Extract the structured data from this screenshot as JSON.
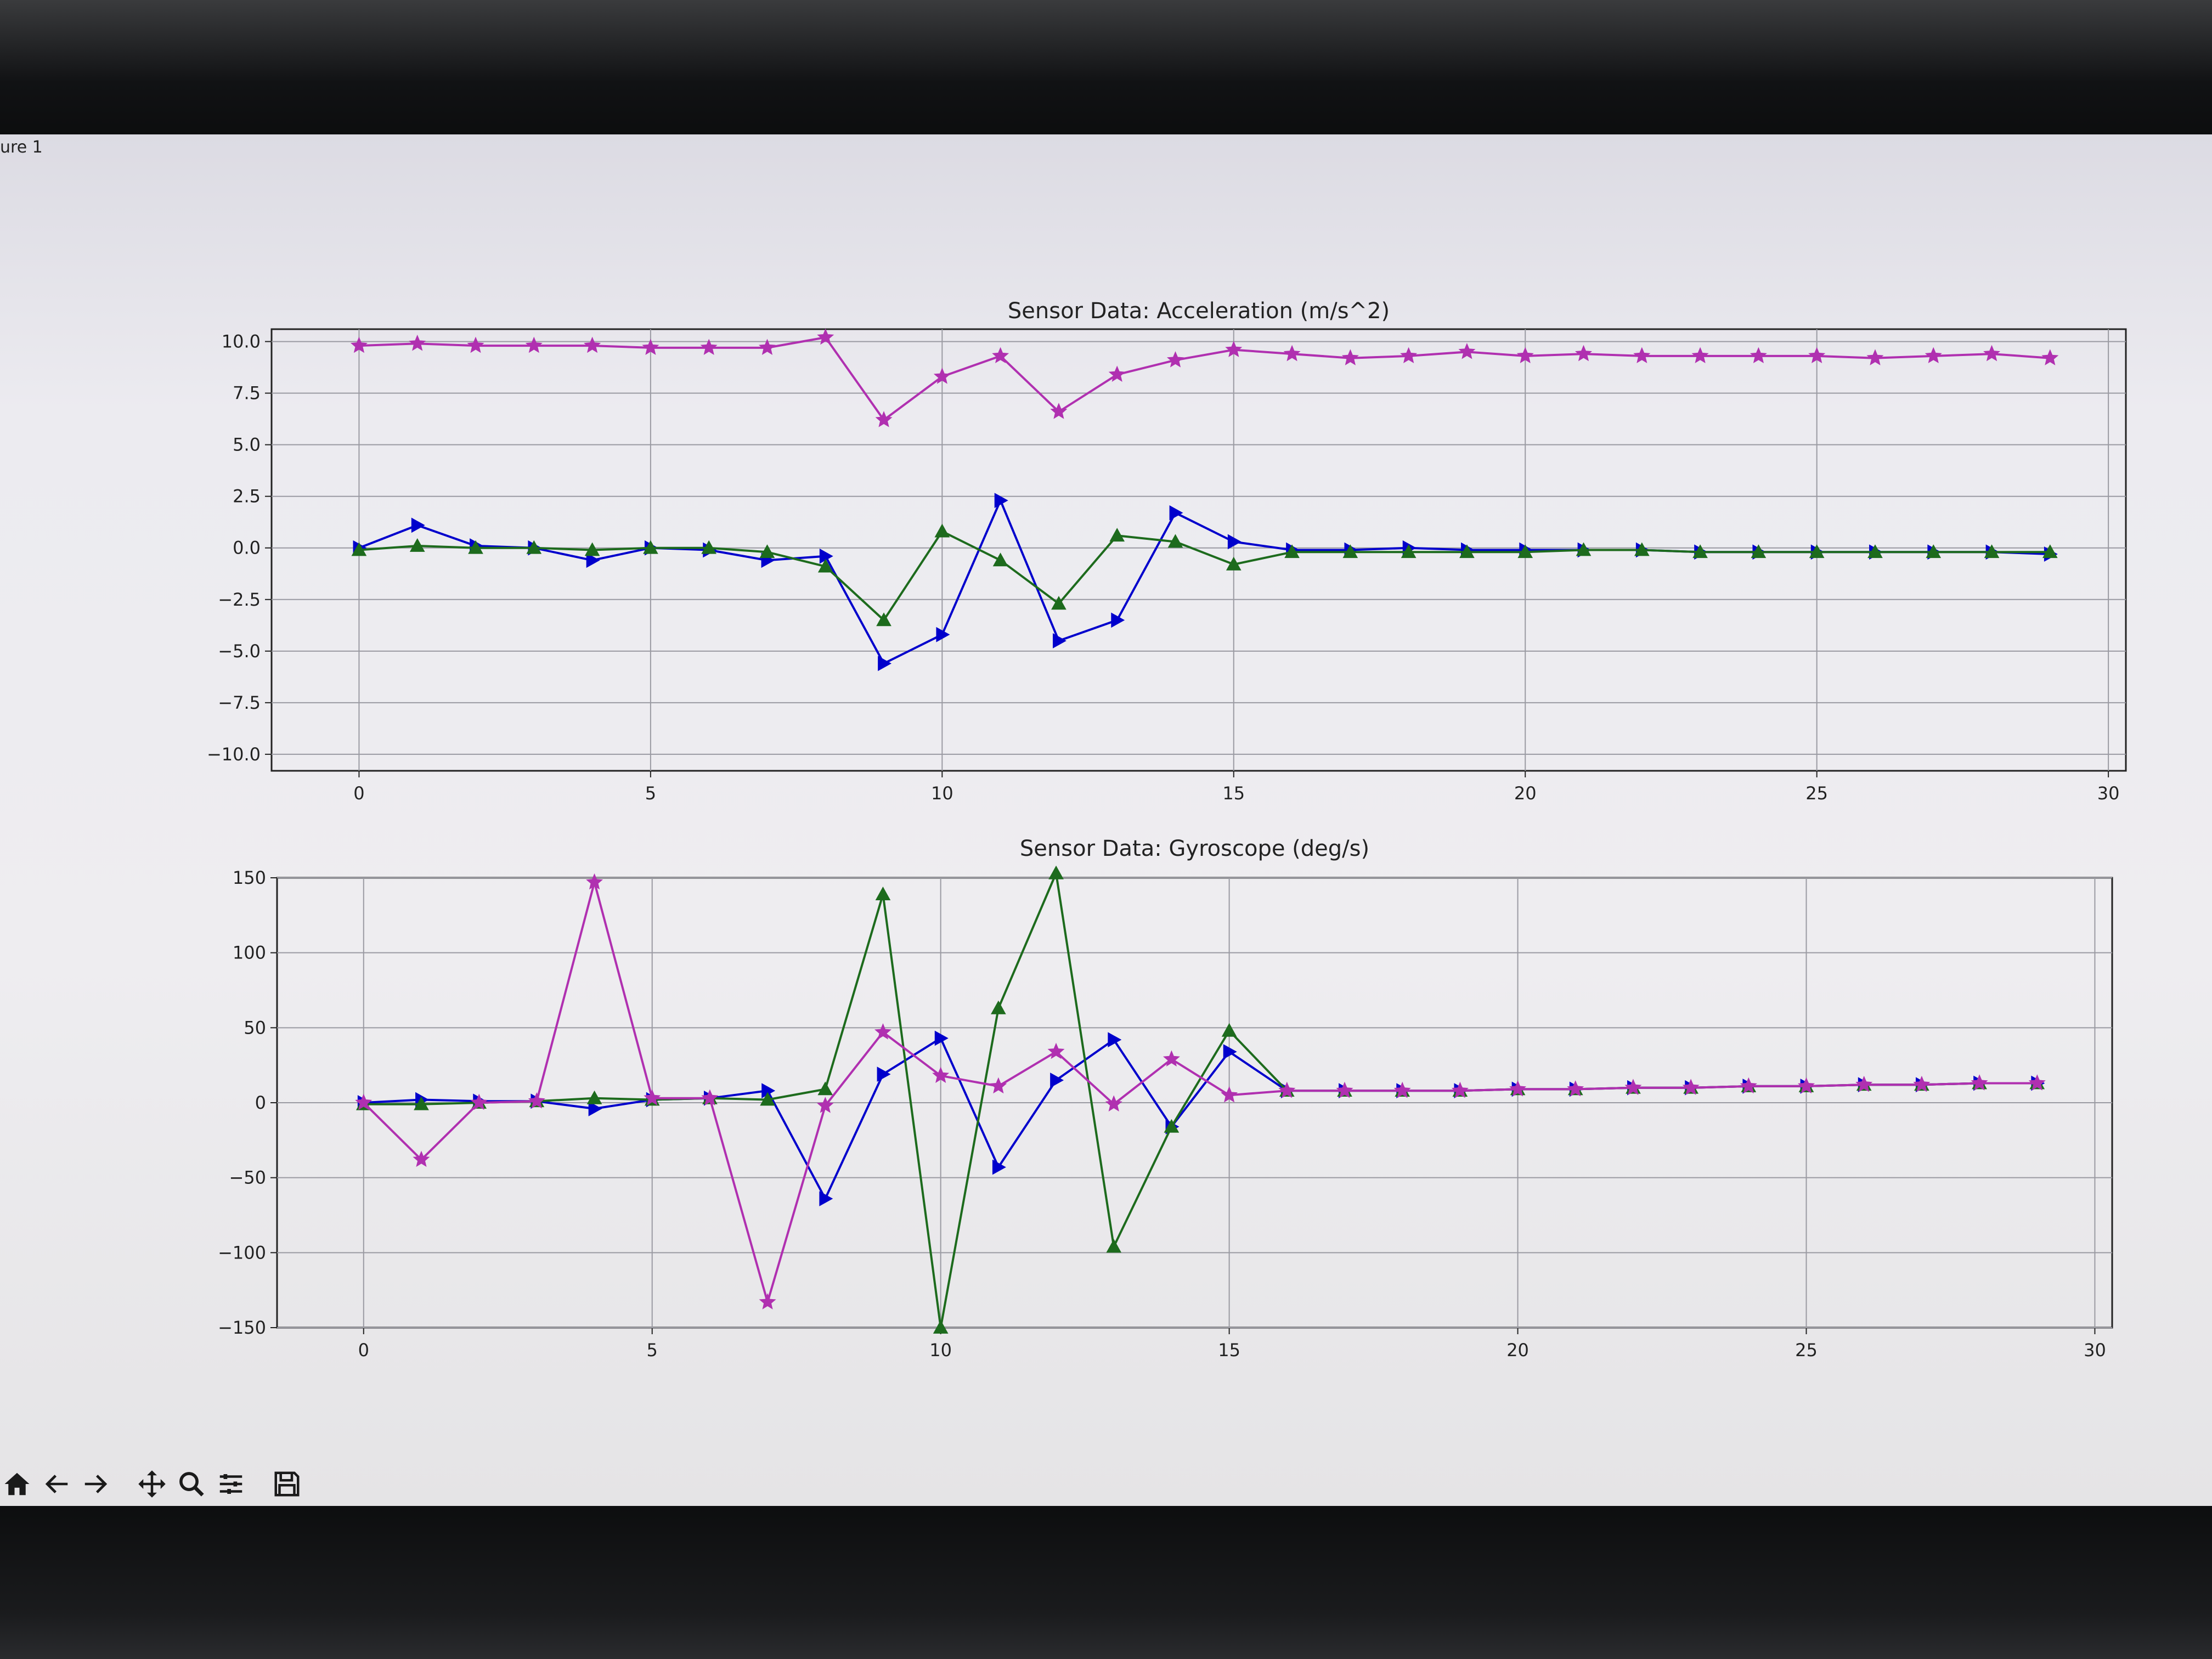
{
  "window": {
    "title": "ure 1"
  },
  "toolbar": {
    "buttons": [
      {
        "name": "home",
        "icon": "home-icon"
      },
      {
        "name": "back",
        "icon": "arrow-left-icon"
      },
      {
        "name": "forward",
        "icon": "arrow-right-icon"
      },
      {
        "name": "pan",
        "icon": "move-icon"
      },
      {
        "name": "zoom",
        "icon": "magnifier-icon"
      },
      {
        "name": "configure",
        "icon": "sliders-icon"
      },
      {
        "name": "save",
        "icon": "floppy-icon"
      }
    ]
  },
  "chart_data": [
    {
      "type": "line",
      "title": "Sensor Data: Acceleration (m/s^2)",
      "xlim": [
        -1.5,
        30.3
      ],
      "ylim": [
        -10.8,
        10.6
      ],
      "xticks": [
        0,
        5,
        10,
        15,
        20,
        25,
        30
      ],
      "yticks": [
        10.0,
        7.5,
        5.0,
        2.5,
        0.0,
        -2.5,
        -5.0,
        -7.5,
        -10.0
      ],
      "ytick_labels": [
        "10.0",
        "7.5",
        "5.0",
        "2.5",
        "0.0",
        "−2.5",
        "−5.0",
        "−7.5",
        "−10.0"
      ],
      "grid": true,
      "x": [
        0,
        1,
        2,
        3,
        4,
        5,
        6,
        7,
        8,
        9,
        10,
        11,
        12,
        13,
        14,
        15,
        16,
        17,
        18,
        19,
        20,
        21,
        22,
        23,
        24,
        25,
        26,
        27,
        28,
        29
      ],
      "series": [
        {
          "color": "#0000cc",
          "marker": "triangle-right",
          "values": [
            0.0,
            1.1,
            0.1,
            0.0,
            -0.6,
            0.0,
            -0.1,
            -0.6,
            -0.4,
            -5.6,
            -4.2,
            2.3,
            -4.5,
            -3.5,
            1.7,
            0.3,
            -0.1,
            -0.1,
            0.0,
            -0.1,
            -0.1,
            -0.1,
            -0.1,
            -0.2,
            -0.2,
            -0.2,
            -0.2,
            -0.2,
            -0.2,
            -0.3
          ]
        },
        {
          "color": "#1d6b1d",
          "marker": "triangle-up",
          "values": [
            -0.1,
            0.1,
            0.0,
            0.0,
            -0.1,
            0.0,
            0.0,
            -0.2,
            -0.9,
            -3.5,
            0.8,
            -0.6,
            -2.7,
            0.6,
            0.3,
            -0.8,
            -0.2,
            -0.2,
            -0.2,
            -0.2,
            -0.2,
            -0.1,
            -0.1,
            -0.2,
            -0.2,
            -0.2,
            -0.2,
            -0.2,
            -0.2,
            -0.2
          ]
        },
        {
          "color": "#b030b0",
          "marker": "star",
          "values": [
            9.8,
            9.9,
            9.8,
            9.8,
            9.8,
            9.7,
            9.7,
            9.7,
            10.2,
            6.2,
            8.3,
            9.3,
            6.6,
            8.4,
            9.1,
            9.6,
            9.4,
            9.2,
            9.3,
            9.5,
            9.3,
            9.4,
            9.3,
            9.3,
            9.3,
            9.3,
            9.2,
            9.3,
            9.4,
            9.2
          ]
        }
      ]
    },
    {
      "type": "line",
      "title": "Sensor Data: Gyroscope (deg/s)",
      "xlim": [
        -1.5,
        30.3
      ],
      "ylim": [
        -150,
        150
      ],
      "xticks": [
        0,
        5,
        10,
        15,
        20,
        25,
        30
      ],
      "yticks": [
        150,
        100,
        50,
        0,
        -50,
        -100,
        -150
      ],
      "ytick_labels": [
        "150",
        "100",
        "50",
        "0",
        "−50",
        "−100",
        "−150"
      ],
      "grid": true,
      "x": [
        0,
        1,
        2,
        3,
        4,
        5,
        6,
        7,
        8,
        9,
        10,
        11,
        12,
        13,
        14,
        15,
        16,
        17,
        18,
        19,
        20,
        21,
        22,
        23,
        24,
        25,
        26,
        27,
        28,
        29
      ],
      "series": [
        {
          "color": "#0000cc",
          "marker": "triangle-right",
          "values": [
            0,
            2,
            1,
            1,
            -4,
            2,
            3,
            8,
            -64,
            19,
            43,
            -43,
            15,
            42,
            -16,
            34,
            8,
            8,
            8,
            8,
            9,
            9,
            10,
            10,
            11,
            11,
            12,
            12,
            13,
            13
          ]
        },
        {
          "color": "#1d6b1d",
          "marker": "triangle-up",
          "values": [
            -1,
            -1,
            0,
            1,
            3,
            2,
            3,
            2,
            9,
            139,
            -150,
            63,
            153,
            -96,
            -16,
            48,
            8,
            8,
            8,
            8,
            9,
            9,
            10,
            10,
            11,
            11,
            12,
            12,
            13,
            13
          ]
        },
        {
          "color": "#b030b0",
          "marker": "star",
          "values": [
            0,
            -38,
            0,
            1,
            147,
            3,
            3,
            -133,
            -2,
            47,
            18,
            11,
            34,
            -1,
            29,
            5,
            8,
            8,
            8,
            8,
            9,
            9,
            10,
            10,
            11,
            11,
            12,
            12,
            13,
            13
          ]
        }
      ]
    }
  ]
}
